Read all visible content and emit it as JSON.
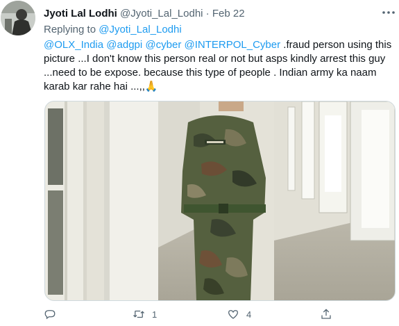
{
  "tweet": {
    "author_name": "Jyoti Lal Lodhi",
    "author_handle": "@Jyoti_Lal_Lodhi",
    "separator": "·",
    "date": "Feb 22",
    "replying_prefix": "Replying to",
    "replying_to": "@Jyoti_Lal_Lodhi",
    "mentions": [
      "@OLX_India",
      "@adgpi",
      "@cyber",
      "@INTERPOL_Cyber"
    ],
    "line1_tail": ".fraud person using this",
    "line2": "picture ...I don't know this person real or not but asps kindly arrest this guy",
    "line3": "...need to be expose. because this type of people . Indian army ka naam",
    "line4": "karab kar rahe hai ...,,",
    "line4_emoji": "🙏"
  },
  "actions": {
    "replies": "",
    "retweets": "1",
    "likes": "4",
    "icons": [
      "reply-icon",
      "retweet-icon",
      "like-icon",
      "share-icon"
    ]
  },
  "colors": {
    "link": "#1d9bf0",
    "secondary": "#536471",
    "uniform_green": "#4f5b3c",
    "wall": "#e6e4da"
  }
}
